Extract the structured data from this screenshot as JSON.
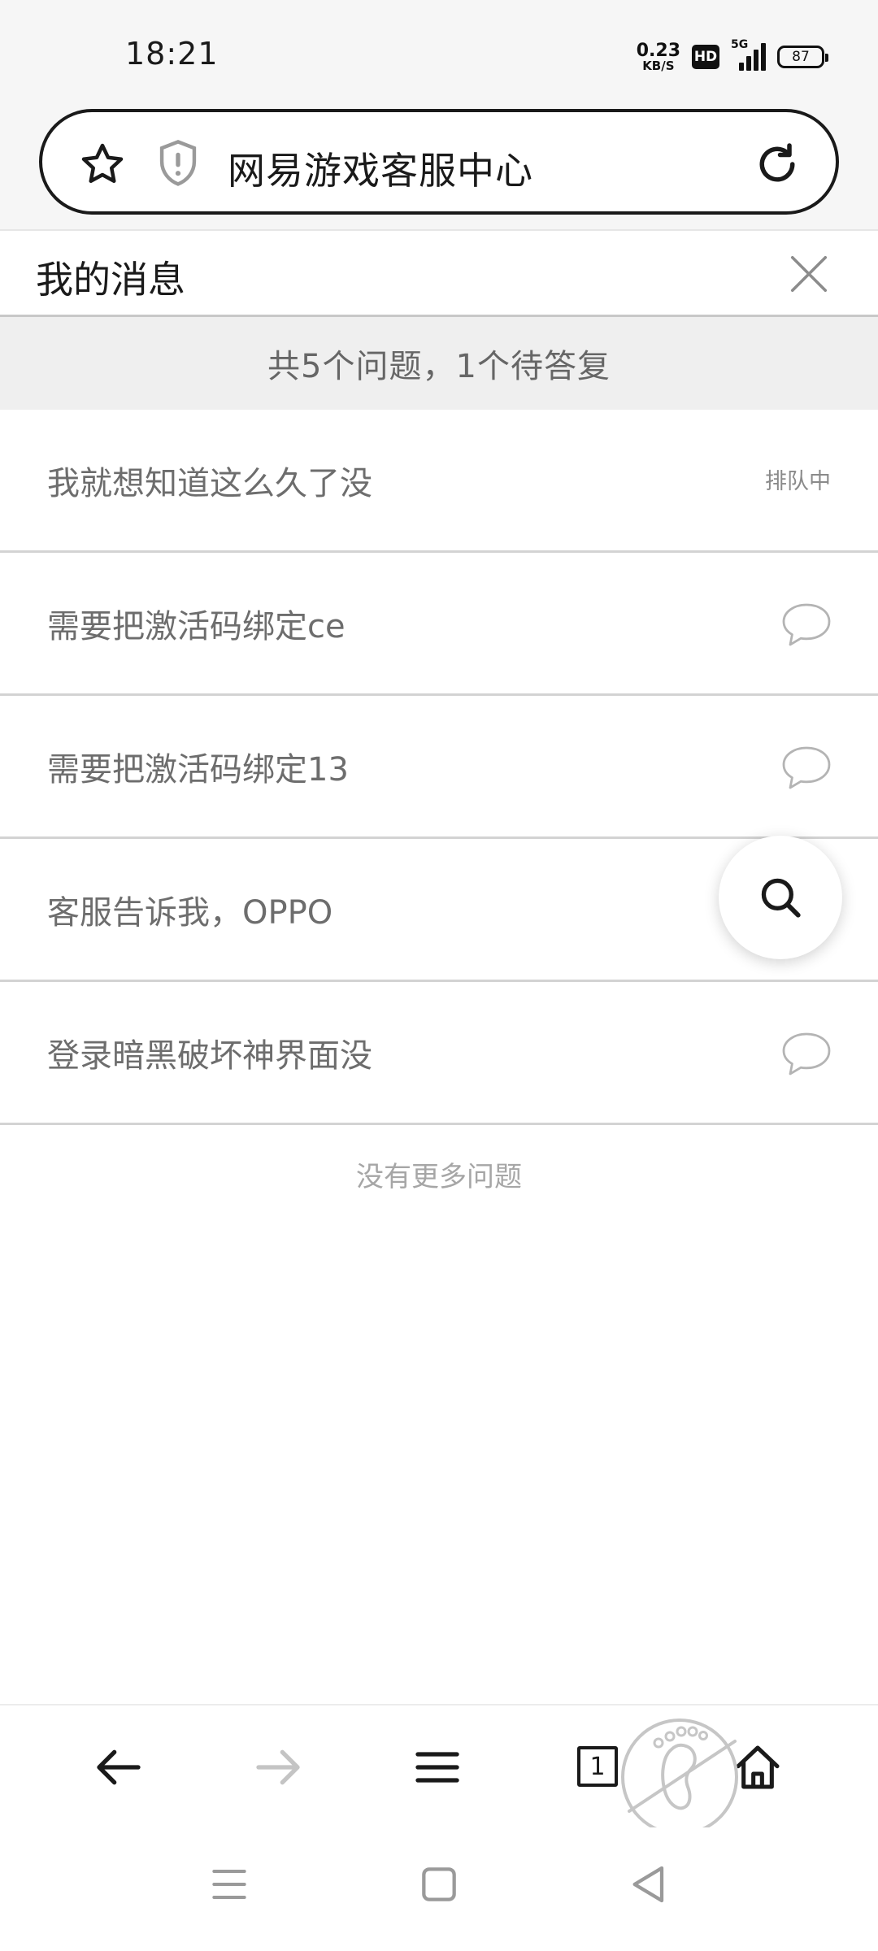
{
  "status_bar": {
    "time": "18:21",
    "net_speed_value": "0.23",
    "net_speed_unit": "KB/S",
    "hd_label": "HD",
    "network_type": "5G",
    "battery_level": "87"
  },
  "address_bar": {
    "title": "网易游戏客服中心",
    "icons": [
      "star-icon",
      "shield-icon",
      "reload-icon"
    ]
  },
  "page": {
    "title": "我的消息",
    "summary": "共5个问题，1个待答复"
  },
  "questions": [
    {
      "text": "我就想知道这么久了没",
      "status": "排队中",
      "icon": ""
    },
    {
      "text": "需要把激活码绑定ce",
      "status": "",
      "icon": "chat-bubble-icon"
    },
    {
      "text": "需要把激活码绑定13",
      "status": "",
      "icon": "chat-bubble-icon"
    },
    {
      "text": "客服告诉我，OPPO",
      "status": "",
      "icon": ""
    },
    {
      "text": "登录暗黑破坏神界面没",
      "status": "",
      "icon": "chat-bubble-icon"
    }
  ],
  "no_more_text": "没有更多问题",
  "toolbar": {
    "tab_count": "1",
    "icons": [
      "back-arrow-icon",
      "forward-arrow-icon",
      "menu-icon",
      "tabs-icon",
      "home-icon"
    ]
  },
  "colors": {
    "text_dark": "#1a1a1a",
    "text_item": "#6d6d6d",
    "summary_bg": "#efefef",
    "divider": "#d3d3d3"
  }
}
